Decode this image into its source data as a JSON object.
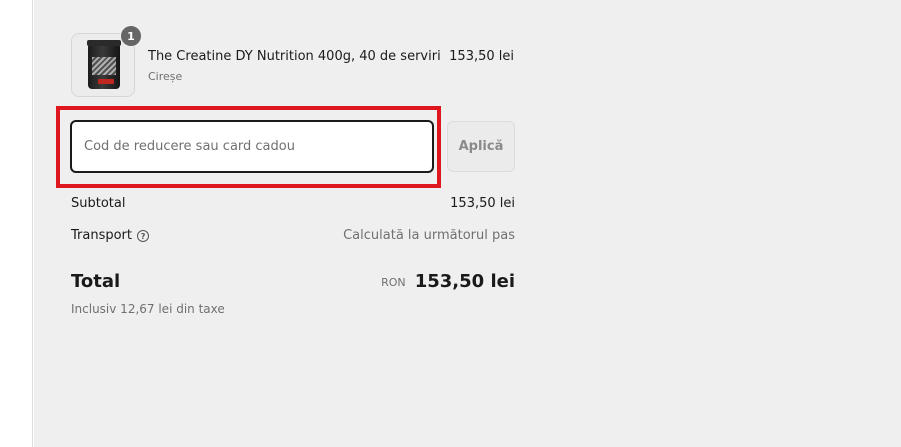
{
  "product": {
    "quantity": "1",
    "name": "The Creatine DY Nutrition 400g, 40 de serviri",
    "variant": "Cireșe",
    "price": "153,50 lei",
    "image_icon": "supplement-tub-icon"
  },
  "discount": {
    "placeholder": "Cod de reducere sau card cadou",
    "value": "",
    "apply_label": "Aplică",
    "highlight_color": "#e0161e"
  },
  "summary": {
    "subtotal_label": "Subtotal",
    "subtotal_value": "153,50 lei",
    "shipping_label": "Transport",
    "shipping_help_icon": "question-circle-icon",
    "shipping_value": "Calculată la următorul pas",
    "total_label": "Total",
    "currency": "RON",
    "total_value": "153,50 lei",
    "tax_note": "Inclusiv 12,67 lei din taxe"
  },
  "colors": {
    "panel_background": "#efefef",
    "text_primary": "#1a1a1a",
    "text_secondary": "#707070"
  }
}
